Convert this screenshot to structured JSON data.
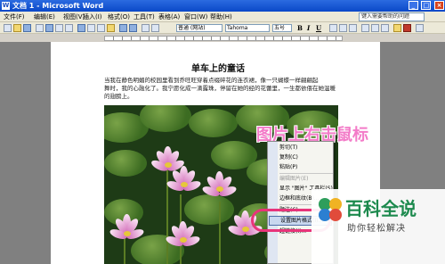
{
  "window": {
    "title": "文档 1 - Microsoft Word",
    "app_icon": "W",
    "min": "_",
    "max": "□",
    "close": "×"
  },
  "menu": {
    "items": [
      "文件(F)",
      "编辑(E)",
      "视图(V)",
      "插入(I)",
      "格式(O)",
      "工具(T)",
      "表格(A)",
      "窗口(W)",
      "帮助(H)"
    ],
    "help_placeholder": "键入需要帮助的问题"
  },
  "toolbar": {
    "style": "普通 (网站)",
    "font": "Tahoma",
    "size": "五号",
    "bold": "B",
    "italic": "I",
    "underline": "U"
  },
  "document": {
    "title": "单车上的童话",
    "lines": [
      "当我在静色明媚的校园里看到乔旺旺穿着点缀碎花的连衣裙，像一只蝴蝶一样翩翩起",
      "舞时，我的心融化了。我宁愿化成一滴露珠，停留在她的经的花蕾里，一生都依偎在她温暖",
      "的翅膀上。"
    ]
  },
  "annotation": {
    "text": "图片上右击鼠标",
    "color": "#f37bc8"
  },
  "context_menu": {
    "items": [
      {
        "label": "剪切(T)",
        "disabled": false
      },
      {
        "label": "复制(C)",
        "disabled": false
      },
      {
        "label": "粘贴(P)",
        "disabled": false
      },
      {
        "label": "编辑图片(E)",
        "disabled": true
      },
      {
        "label": "显示 \"图片\" 工具栏(S)",
        "disabled": false
      },
      {
        "label": "边框和底纹(B)...",
        "disabled": false
      },
      {
        "label": "题注(C)...",
        "disabled": false
      },
      {
        "label": "设置图片格式(I)...",
        "disabled": false,
        "selected": true
      },
      {
        "label": "超链接(I)...",
        "disabled": false
      }
    ]
  },
  "watermark": {
    "title": "百科全说",
    "subtitle": "助你轻松解决",
    "color": "#1d8a4e"
  }
}
